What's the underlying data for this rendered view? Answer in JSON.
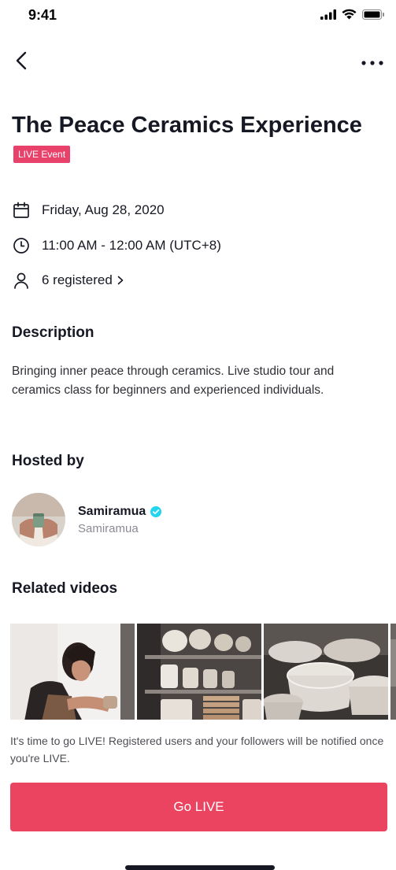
{
  "status_bar": {
    "time": "9:41",
    "icons": [
      "cellular-signal-icon",
      "wifi-icon",
      "battery-icon"
    ]
  },
  "nav": {
    "back_icon": "chevron-left-icon",
    "more_icon": "more-horizontal-icon"
  },
  "event": {
    "title": "The Peace Ceramics Experience",
    "badge": "LIVE Event",
    "date": "Friday, Aug 28, 2020",
    "time": "11:00 AM - 12:00 AM (UTC+8)",
    "registered": "6 registered"
  },
  "description": {
    "heading": "Description",
    "text": "Bringing inner peace through ceramics. Live studio tour and ceramics class for beginners and experienced individuals."
  },
  "host": {
    "heading": "Hosted by",
    "name": "Samiramua",
    "handle": "Samiramua",
    "verified": true
  },
  "related": {
    "heading": "Related videos",
    "videos": [
      {
        "subject": "woman-working-clay"
      },
      {
        "subject": "pottery-shelves"
      },
      {
        "subject": "ceramic-bowls"
      }
    ]
  },
  "footer": {
    "notice": "It's time to go LIVE! Registered users and your followers will be notified once you're LIVE.",
    "go_live_label": "Go LIVE"
  },
  "colors": {
    "accent": "#ea4460",
    "badge": "#e8416a",
    "verified": "#20d5ec",
    "text": "#161823",
    "muted": "#8a8b91"
  }
}
